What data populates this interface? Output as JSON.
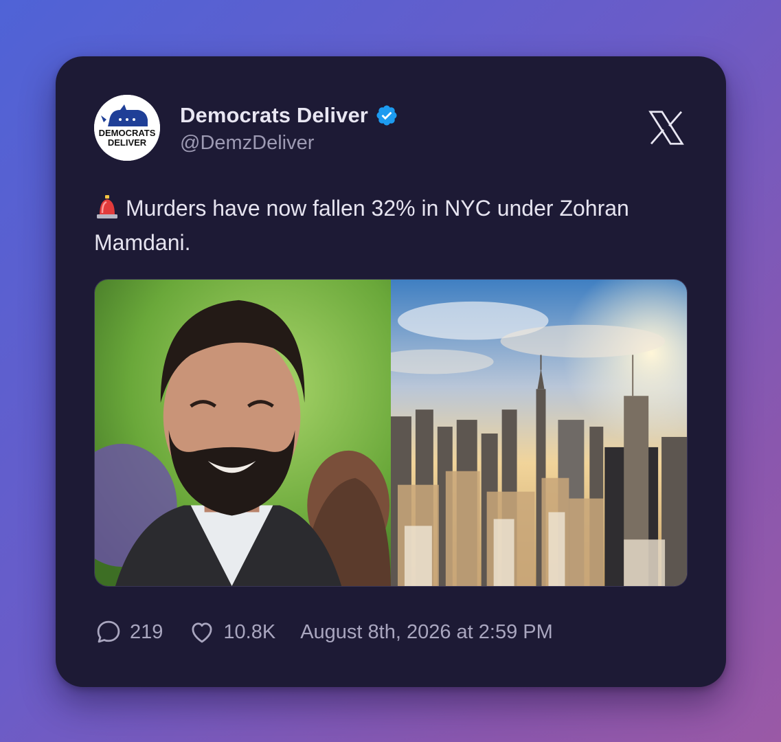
{
  "post": {
    "display_name": "Democrats Deliver",
    "handle": "@DemzDeliver",
    "avatar_text_line1": "DEMOCRATS",
    "avatar_text_line2": "DELIVER",
    "verified": true,
    "platform_icon": "x-logo-icon",
    "emoji": "police-light-emoji",
    "text": "Murders have now fallen 32% in NYC under Zohran Mamdani.",
    "images": [
      {
        "subject": "smiling bearded man in dark jacket outdoors"
      },
      {
        "subject": "aerial view of New York City skyline at sunset"
      }
    ]
  },
  "footer": {
    "reply_icon": "comment-icon",
    "replies": "219",
    "like_icon": "heart-icon",
    "likes": "10.8K",
    "timestamp": "August 8th, 2026 at 2:59 PM"
  },
  "colors": {
    "card_bg": "#1d1a35",
    "verified_blue": "#1d9bf0",
    "avatar_blue": "#1f3f97"
  }
}
